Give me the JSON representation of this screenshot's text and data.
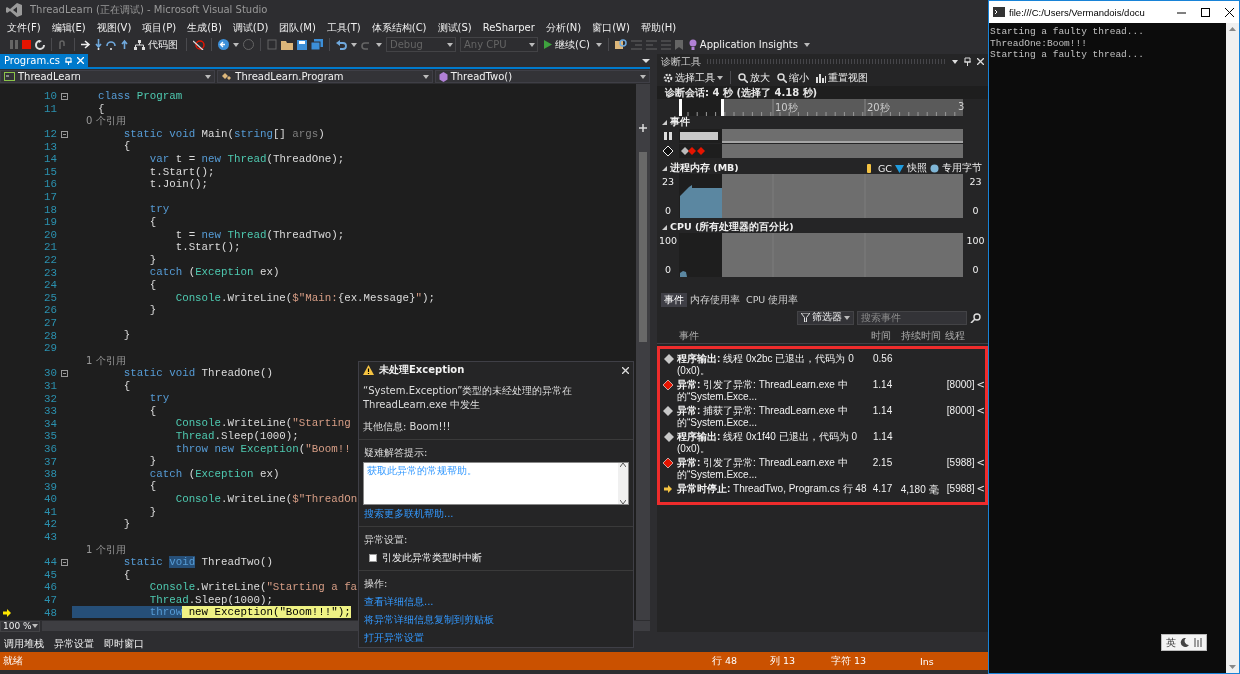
{
  "window": {
    "title": "ThreadLearn (正在调试) - Microsoft Visual Studio"
  },
  "menu": [
    "文件(F)",
    "编辑(E)",
    "视图(V)",
    "项目(P)",
    "生成(B)",
    "调试(D)",
    "团队(M)",
    "工具(T)",
    "体系结构(C)",
    "测试(S)",
    "ReSharper",
    "分析(N)",
    "窗口(W)",
    "帮助(H)"
  ],
  "toolbar": {
    "code_map": "代码图",
    "configuration": {
      "value": "Debug",
      "disabled": true
    },
    "platform": {
      "value": "Any CPU",
      "disabled": true
    },
    "continue": "继续(C)",
    "insights": "Application Insights"
  },
  "editor": {
    "tabs": [
      {
        "label": "Program.cs",
        "selected": true
      }
    ],
    "nav": [
      "ThreadLearn",
      "ThreadLearn.Program",
      "ThreadTwo()"
    ],
    "lines": [
      {
        "kind": "code",
        "number": "10",
        "fold": true,
        "current": false,
        "tokens": [
          {
            "text": "    class ",
            "kind": "keyword"
          },
          {
            "text": "Program",
            "kind": "type"
          }
        ]
      },
      {
        "kind": "code",
        "number": "11",
        "fold": false,
        "current": false,
        "tokens": [
          {
            "text": "    {",
            "kind": "plain"
          }
        ]
      },
      {
        "kind": "codelens",
        "text": "0 个引用"
      },
      {
        "kind": "code",
        "number": "12",
        "fold": true,
        "current": false,
        "tokens": [
          {
            "text": "        static void",
            "kind": "keyword"
          },
          {
            "text": " Main(",
            "kind": "plain"
          },
          {
            "text": "string",
            "kind": "keyword"
          },
          {
            "text": "[] ",
            "kind": "plain"
          },
          {
            "text": "args",
            "kind": "unused"
          },
          {
            "text": ")",
            "kind": "plain"
          }
        ]
      },
      {
        "kind": "code",
        "number": "13",
        "fold": false,
        "current": false,
        "tokens": [
          {
            "text": "        {",
            "kind": "plain"
          }
        ]
      },
      {
        "kind": "code",
        "number": "14",
        "fold": false,
        "current": false,
        "tokens": [
          {
            "text": "            var",
            "kind": "keyword"
          },
          {
            "text": " t = ",
            "kind": "plain"
          },
          {
            "text": "new ",
            "kind": "keyword"
          },
          {
            "text": "Thread",
            "kind": "type"
          },
          {
            "text": "(ThreadOne);",
            "kind": "plain"
          }
        ]
      },
      {
        "kind": "code",
        "number": "15",
        "fold": false,
        "current": false,
        "tokens": [
          {
            "text": "            t.Start();",
            "kind": "plain"
          }
        ]
      },
      {
        "kind": "code",
        "number": "16",
        "fold": false,
        "current": false,
        "tokens": [
          {
            "text": "            t.Join();",
            "kind": "plain"
          }
        ]
      },
      {
        "kind": "code",
        "number": "17",
        "fold": false,
        "current": false
      },
      {
        "kind": "code",
        "number": "18",
        "fold": false,
        "current": false,
        "tokens": [
          {
            "text": "            try",
            "kind": "keyword"
          }
        ]
      },
      {
        "kind": "code",
        "number": "19",
        "fold": false,
        "current": false,
        "tokens": [
          {
            "text": "            {",
            "kind": "plain"
          }
        ]
      },
      {
        "kind": "code",
        "number": "20",
        "fold": false,
        "current": false,
        "tokens": [
          {
            "text": "                t = ",
            "kind": "plain"
          },
          {
            "text": "new ",
            "kind": "keyword"
          },
          {
            "text": "Thread",
            "kind": "type"
          },
          {
            "text": "(ThreadTwo);",
            "kind": "plain"
          }
        ]
      },
      {
        "kind": "code",
        "number": "21",
        "fold": false,
        "current": false,
        "tokens": [
          {
            "text": "                t.Start();",
            "kind": "plain"
          }
        ]
      },
      {
        "kind": "code",
        "number": "22",
        "fold": false,
        "current": false,
        "tokens": [
          {
            "text": "            }",
            "kind": "plain"
          }
        ]
      },
      {
        "kind": "code",
        "number": "23",
        "fold": false,
        "current": false,
        "tokens": [
          {
            "text": "            catch",
            "kind": "keyword"
          },
          {
            "text": " (",
            "kind": "plain"
          },
          {
            "text": "Exception",
            "kind": "type"
          },
          {
            "text": " ex)",
            "kind": "plain"
          }
        ]
      },
      {
        "kind": "code",
        "number": "24",
        "fold": false,
        "current": false,
        "tokens": [
          {
            "text": "            {",
            "kind": "plain"
          }
        ]
      },
      {
        "kind": "code",
        "number": "25",
        "fold": false,
        "current": false,
        "tokens": [
          {
            "text": "                Console",
            "kind": "type"
          },
          {
            "text": ".WriteLine(",
            "kind": "plain"
          },
          {
            "text": "$\"Main:",
            "kind": "string"
          },
          {
            "text": "{ex.Message}",
            "kind": "plain"
          },
          {
            "text": "\"",
            "kind": "string"
          },
          {
            "text": ");",
            "kind": "plain"
          }
        ]
      },
      {
        "kind": "code",
        "number": "26",
        "fold": false,
        "current": false,
        "tokens": [
          {
            "text": "            }",
            "kind": "plain"
          }
        ]
      },
      {
        "kind": "code",
        "number": "27",
        "fold": false,
        "current": false
      },
      {
        "kind": "code",
        "number": "28",
        "fold": false,
        "current": false,
        "tokens": [
          {
            "text": "        }",
            "kind": "plain"
          }
        ]
      },
      {
        "kind": "code",
        "number": "29",
        "fold": false,
        "current": false
      },
      {
        "kind": "codelens",
        "text": "1 个引用"
      },
      {
        "kind": "code",
        "number": "30",
        "fold": true,
        "current": false,
        "tokens": [
          {
            "text": "        static void",
            "kind": "keyword"
          },
          {
            "text": " ThreadOne()",
            "kind": "plain"
          }
        ]
      },
      {
        "kind": "code",
        "number": "31",
        "fold": false,
        "current": false,
        "tokens": [
          {
            "text": "        {",
            "kind": "plain"
          }
        ]
      },
      {
        "kind": "code",
        "number": "32",
        "fold": false,
        "current": false,
        "tokens": [
          {
            "text": "            try",
            "kind": "keyword"
          }
        ]
      },
      {
        "kind": "code",
        "number": "33",
        "fold": false,
        "current": false,
        "tokens": [
          {
            "text": "            {",
            "kind": "plain"
          }
        ]
      },
      {
        "kind": "code",
        "number": "34",
        "fold": false,
        "current": false,
        "tokens": [
          {
            "text": "                Console",
            "kind": "type"
          },
          {
            "text": ".WriteLine(",
            "kind": "plain"
          },
          {
            "text": "\"Starting",
            "kind": "string"
          }
        ]
      },
      {
        "kind": "code",
        "number": "35",
        "fold": false,
        "current": false,
        "tokens": [
          {
            "text": "                Thread",
            "kind": "type"
          },
          {
            "text": ".Sleep(1000);",
            "kind": "plain"
          }
        ]
      },
      {
        "kind": "code",
        "number": "36",
        "fold": false,
        "current": false,
        "tokens": [
          {
            "text": "                throw new ",
            "kind": "keyword"
          },
          {
            "text": "Exception",
            "kind": "type"
          },
          {
            "text": "(",
            "kind": "plain"
          },
          {
            "text": "\"Boom!!",
            "kind": "string"
          }
        ]
      },
      {
        "kind": "code",
        "number": "37",
        "fold": false,
        "current": false,
        "tokens": [
          {
            "text": "            }",
            "kind": "plain"
          }
        ]
      },
      {
        "kind": "code",
        "number": "38",
        "fold": false,
        "current": false,
        "tokens": [
          {
            "text": "            catch",
            "kind": "keyword"
          },
          {
            "text": " (",
            "kind": "plain"
          },
          {
            "text": "Exception",
            "kind": "type"
          },
          {
            "text": " ex)",
            "kind": "plain"
          }
        ]
      },
      {
        "kind": "code",
        "number": "39",
        "fold": false,
        "current": false,
        "tokens": [
          {
            "text": "            {",
            "kind": "plain"
          }
        ]
      },
      {
        "kind": "code",
        "number": "40",
        "fold": false,
        "current": false,
        "tokens": [
          {
            "text": "                Console",
            "kind": "type"
          },
          {
            "text": ".WriteLine(",
            "kind": "plain"
          },
          {
            "text": "$\"ThreadOn",
            "kind": "string"
          }
        ]
      },
      {
        "kind": "code",
        "number": "41",
        "fold": false,
        "current": false,
        "tokens": [
          {
            "text": "            }",
            "kind": "plain"
          }
        ]
      },
      {
        "kind": "code",
        "number": "42",
        "fold": false,
        "current": false,
        "tokens": [
          {
            "text": "        }",
            "kind": "plain"
          }
        ]
      },
      {
        "kind": "code",
        "number": "43",
        "fold": false,
        "current": false
      },
      {
        "kind": "codelens",
        "text": "1 个引用"
      },
      {
        "kind": "code",
        "number": "44",
        "fold": true,
        "current": false,
        "tokens": [
          {
            "text": "        static ",
            "kind": "keyword"
          },
          {
            "text": "void",
            "kind": "selected"
          },
          {
            "text": " ThreadTwo()",
            "kind": "plain"
          }
        ]
      },
      {
        "kind": "code",
        "number": "45",
        "fold": false,
        "current": false,
        "tokens": [
          {
            "text": "        {",
            "kind": "plain"
          }
        ]
      },
      {
        "kind": "code",
        "number": "46",
        "fold": false,
        "current": false,
        "tokens": [
          {
            "text": "            Console",
            "kind": "type"
          },
          {
            "text": ".WriteLine(",
            "kind": "plain"
          },
          {
            "text": "\"Starting a fa",
            "kind": "string"
          }
        ]
      },
      {
        "kind": "code",
        "number": "47",
        "fold": false,
        "current": false,
        "tokens": [
          {
            "text": "            Thread",
            "kind": "type"
          },
          {
            "text": ".Sleep(1000);",
            "kind": "plain"
          }
        ]
      },
      {
        "kind": "code",
        "number": "48",
        "fold": false,
        "current": true,
        "tokens": [
          {
            "text": "            throw",
            "kind": "selected"
          },
          {
            "text": " new ",
            "kind": "keyword"
          },
          {
            "text": "Exception",
            "kind": "type"
          },
          {
            "text": "(",
            "kind": "plain"
          },
          {
            "text": "\"Boom!!!\"",
            "kind": "string"
          },
          {
            "text": ");",
            "kind": "plain"
          }
        ]
      }
    ],
    "zoom": "100 %"
  },
  "exception_dialog": {
    "title": "未处理Exception",
    "message": "“System.Exception”类型的未经处理的异常在 ThreadLearn.exe 中发生",
    "info": "其他信息: Boom!!!",
    "tips_label": "疑难解答提示:",
    "tips": [
      "获取此异常的常规帮助。"
    ],
    "search_link": "搜索更多联机帮助...",
    "settings_label": "异常设置:",
    "break_option": {
      "label": "引发此异常类型时中断",
      "checked": false
    },
    "actions_label": "操作:",
    "actions": [
      "查看详细信息...",
      "将异常详细信息复制到剪贴板",
      "打开异常设置"
    ]
  },
  "diagnostics": {
    "title": "诊断工具",
    "toolbar": {
      "select_tools": "选择工具",
      "zoom_in": "放大",
      "zoom_out": "缩小",
      "reset_view": "重置视图"
    },
    "session": "诊断会话: 4 秒 (选择了 4.18 秒)",
    "ruler": [
      "10秒",
      "20秒",
      "3"
    ],
    "events_section": "事件",
    "memory": {
      "title": "进程内存 (MB)",
      "legend": [
        "GC",
        "快照",
        "专用字节"
      ],
      "left_max": "23",
      "left_min": "0",
      "right_max": "23",
      "right_min": "0"
    },
    "cpu": {
      "title": "CPU (所有处理器的百分比)",
      "left_max": "100",
      "left_min": "0",
      "right_max": "100",
      "right_min": "0"
    },
    "tabs": [
      {
        "label": "事件",
        "selected": true
      },
      {
        "label": "内存使用率",
        "selected": false
      },
      {
        "label": "CPU 使用率",
        "selected": false
      }
    ],
    "filter": "筛选器",
    "search": {
      "placeholder": "搜索事件"
    },
    "columns": [
      "事件",
      "时间",
      "持续时间",
      "线程"
    ],
    "annotated": true,
    "events": [
      {
        "kind": "output",
        "label": "程序输出:",
        "text": "线程 0x2bc 已退出，代码为 0 (0x0)。",
        "time": "0.56"
      },
      {
        "kind": "thrown",
        "label": "异常:",
        "text": "引发了异常: ThreadLearn.exe 中的“System.Exce...",
        "time": "1.14",
        "thread": "[8000]",
        "more": "<"
      },
      {
        "kind": "caught",
        "label": "异常:",
        "text": "捕获了异常: ThreadLearn.exe 中的“System.Exce...",
        "time": "1.14",
        "thread": "[8000]",
        "more": "<"
      },
      {
        "kind": "output",
        "label": "程序输出:",
        "text": "线程 0x1f40 已退出，代码为 0 (0x0)。",
        "time": "1.14"
      },
      {
        "kind": "thrown",
        "label": "异常:",
        "text": "引发了异常: ThreadLearn.exe 中的“System.Exce...",
        "time": "2.15",
        "thread": "[5988]",
        "more": "<"
      },
      {
        "kind": "break",
        "label": "异常时停止:",
        "text": "ThreadTwo, Program.cs 行 48",
        "time": "4.17",
        "duration": "4,180 毫",
        "thread": "[5988]",
        "more": "<"
      }
    ]
  },
  "bottom_tabs": [
    "调用堆栈",
    "异常设置",
    "即时窗口"
  ],
  "status_bar": {
    "state": "就绪",
    "line": "行 48",
    "column": "列 13",
    "char": "字符 13",
    "mode": "Ins"
  },
  "console": {
    "title": "file:///C:/Users/Vermandois/docu",
    "lines": [
      "Starting a faulty thread...",
      "ThreadOne:Boom!!!",
      "Starting a faulty thread..."
    ],
    "ime": "英"
  }
}
